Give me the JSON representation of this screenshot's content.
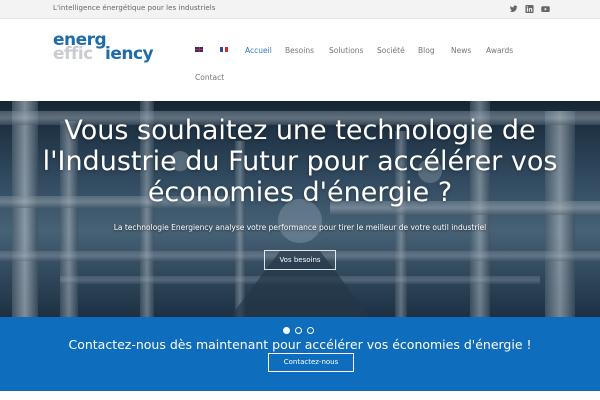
{
  "topbar": {
    "tagline": "L'intelligence énergétique pour les industriels",
    "socials": [
      "twitter-icon",
      "linkedin-icon",
      "youtube-icon"
    ]
  },
  "logo": {
    "line1": "energ",
    "line2_ghost": "effic",
    "line2": "iency"
  },
  "nav": {
    "languages": [
      "English",
      "Français"
    ],
    "items": [
      "Accueil",
      "Besoins",
      "Solutions",
      "Société",
      "Blog",
      "News",
      "Awards",
      "Contact"
    ],
    "active": "Accueil"
  },
  "hero": {
    "title": "Vous souhaitez une technologie de l'Industrie du Futur pour accélérer vos économies d'énergie ?",
    "subtitle": "La technologie Energiency analyse votre performance pour tirer le meilleur de votre outil industriel",
    "button": "Vos besoins"
  },
  "slider": {
    "count": 3,
    "active_index": 0
  },
  "cta": {
    "text": "Contactez-nous dès maintenant pour accélérer vos économies d'énergie !",
    "button": "Contactez-nous"
  },
  "colors": {
    "brand_blue": "#1f6ca8",
    "band_blue": "#0f6dbd",
    "nav_active": "#2f7ec1"
  }
}
